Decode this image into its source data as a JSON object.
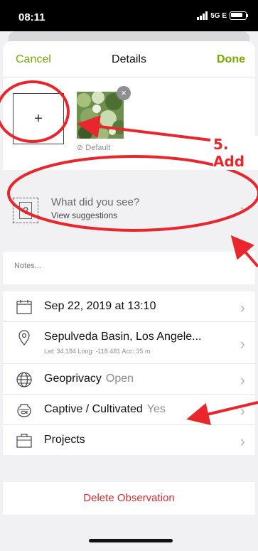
{
  "status": {
    "time": "08:11",
    "network": "5G E"
  },
  "nav": {
    "cancel": "Cancel",
    "title": "Details",
    "done": "Done"
  },
  "photos": {
    "add_symbol": "+",
    "close_symbol": "×",
    "default_label": "Default"
  },
  "species": {
    "prompt": "What did you see?",
    "suggestions": "View suggestions"
  },
  "notes": {
    "placeholder": "Notes..."
  },
  "rows": {
    "date": "Sep 22, 2019 at 13:10",
    "location": "Sepulveda Basin, Los Angele...",
    "location_meta": "Lat: 34.184  Long: -118.481  Acc: 35 m",
    "geoprivacy_label": "Geoprivacy",
    "geoprivacy_value": "Open",
    "captive_label": "Captive / Cultivated",
    "captive_value": "Yes",
    "projects_label": "Projects"
  },
  "actions": {
    "delete": "Delete Observation"
  },
  "annotation": {
    "text": "5. Add"
  },
  "colors": {
    "accent": "#74ac00",
    "danger": "#e8262c",
    "annotation": "#e8262c"
  },
  "icons": [
    "signal-icon",
    "battery-icon",
    "close-icon",
    "question-icon",
    "chevron-right-icon",
    "calendar-icon",
    "location-pin-icon",
    "globe-icon",
    "fishbowl-icon",
    "briefcase-icon"
  ]
}
